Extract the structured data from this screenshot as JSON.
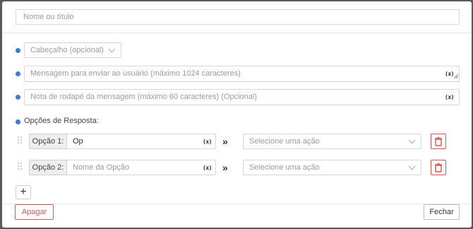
{
  "title_placeholder": "Nome ou título",
  "header_select": {
    "value": "Cabeçalho (opcional)"
  },
  "message": {
    "placeholder": "Mensagem para enviar ao usuário (máximo 1024 caracteres)",
    "var_label": "(x)"
  },
  "footer_note": {
    "placeholder": "Nota de rodapé da mensagem (máximo 60 caracteres) (Opcional)",
    "var_label": "(x)"
  },
  "options_label": "Opções de Resposta:",
  "options": [
    {
      "label": "Opção 1:",
      "value": "Op",
      "placeholder": "Nome da Opção",
      "var_label": "(x)",
      "arrow": "»",
      "action_placeholder": "Selecione uma ação"
    },
    {
      "label": "Opção 2:",
      "value": "",
      "placeholder": "Nome da Opção",
      "var_label": "(x)",
      "arrow": "»",
      "action_placeholder": "Selecione uma ação"
    }
  ],
  "add_button": "+",
  "buttons": {
    "delete": "Apagar",
    "close": "Fechar"
  },
  "icons": {
    "trash": "trash-icon",
    "drag": "drag-handle-icon",
    "info": "info-dot-icon",
    "chevron": "chevron-down-icon"
  },
  "colors": {
    "accent_blue": "#3a7bd5",
    "danger": "#d9534f",
    "overlay": "#5a5a5a"
  }
}
